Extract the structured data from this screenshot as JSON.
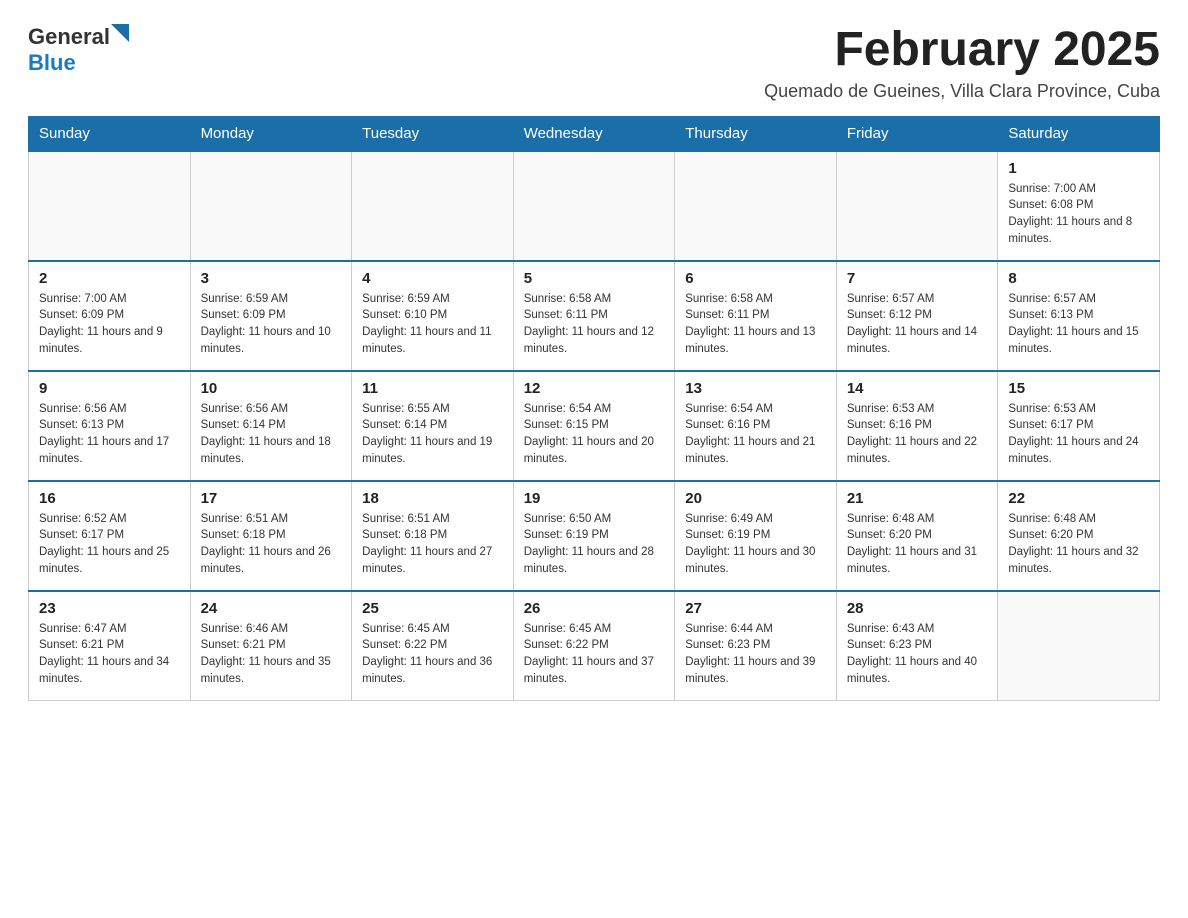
{
  "header": {
    "logo_general": "General",
    "logo_blue": "Blue",
    "month_title": "February 2025",
    "location": "Quemado de Gueines, Villa Clara Province, Cuba"
  },
  "days_of_week": [
    "Sunday",
    "Monday",
    "Tuesday",
    "Wednesday",
    "Thursday",
    "Friday",
    "Saturday"
  ],
  "weeks": [
    [
      {
        "day": "",
        "info": ""
      },
      {
        "day": "",
        "info": ""
      },
      {
        "day": "",
        "info": ""
      },
      {
        "day": "",
        "info": ""
      },
      {
        "day": "",
        "info": ""
      },
      {
        "day": "",
        "info": ""
      },
      {
        "day": "1",
        "info": "Sunrise: 7:00 AM\nSunset: 6:08 PM\nDaylight: 11 hours and 8 minutes."
      }
    ],
    [
      {
        "day": "2",
        "info": "Sunrise: 7:00 AM\nSunset: 6:09 PM\nDaylight: 11 hours and 9 minutes."
      },
      {
        "day": "3",
        "info": "Sunrise: 6:59 AM\nSunset: 6:09 PM\nDaylight: 11 hours and 10 minutes."
      },
      {
        "day": "4",
        "info": "Sunrise: 6:59 AM\nSunset: 6:10 PM\nDaylight: 11 hours and 11 minutes."
      },
      {
        "day": "5",
        "info": "Sunrise: 6:58 AM\nSunset: 6:11 PM\nDaylight: 11 hours and 12 minutes."
      },
      {
        "day": "6",
        "info": "Sunrise: 6:58 AM\nSunset: 6:11 PM\nDaylight: 11 hours and 13 minutes."
      },
      {
        "day": "7",
        "info": "Sunrise: 6:57 AM\nSunset: 6:12 PM\nDaylight: 11 hours and 14 minutes."
      },
      {
        "day": "8",
        "info": "Sunrise: 6:57 AM\nSunset: 6:13 PM\nDaylight: 11 hours and 15 minutes."
      }
    ],
    [
      {
        "day": "9",
        "info": "Sunrise: 6:56 AM\nSunset: 6:13 PM\nDaylight: 11 hours and 17 minutes."
      },
      {
        "day": "10",
        "info": "Sunrise: 6:56 AM\nSunset: 6:14 PM\nDaylight: 11 hours and 18 minutes."
      },
      {
        "day": "11",
        "info": "Sunrise: 6:55 AM\nSunset: 6:14 PM\nDaylight: 11 hours and 19 minutes."
      },
      {
        "day": "12",
        "info": "Sunrise: 6:54 AM\nSunset: 6:15 PM\nDaylight: 11 hours and 20 minutes."
      },
      {
        "day": "13",
        "info": "Sunrise: 6:54 AM\nSunset: 6:16 PM\nDaylight: 11 hours and 21 minutes."
      },
      {
        "day": "14",
        "info": "Sunrise: 6:53 AM\nSunset: 6:16 PM\nDaylight: 11 hours and 22 minutes."
      },
      {
        "day": "15",
        "info": "Sunrise: 6:53 AM\nSunset: 6:17 PM\nDaylight: 11 hours and 24 minutes."
      }
    ],
    [
      {
        "day": "16",
        "info": "Sunrise: 6:52 AM\nSunset: 6:17 PM\nDaylight: 11 hours and 25 minutes."
      },
      {
        "day": "17",
        "info": "Sunrise: 6:51 AM\nSunset: 6:18 PM\nDaylight: 11 hours and 26 minutes."
      },
      {
        "day": "18",
        "info": "Sunrise: 6:51 AM\nSunset: 6:18 PM\nDaylight: 11 hours and 27 minutes."
      },
      {
        "day": "19",
        "info": "Sunrise: 6:50 AM\nSunset: 6:19 PM\nDaylight: 11 hours and 28 minutes."
      },
      {
        "day": "20",
        "info": "Sunrise: 6:49 AM\nSunset: 6:19 PM\nDaylight: 11 hours and 30 minutes."
      },
      {
        "day": "21",
        "info": "Sunrise: 6:48 AM\nSunset: 6:20 PM\nDaylight: 11 hours and 31 minutes."
      },
      {
        "day": "22",
        "info": "Sunrise: 6:48 AM\nSunset: 6:20 PM\nDaylight: 11 hours and 32 minutes."
      }
    ],
    [
      {
        "day": "23",
        "info": "Sunrise: 6:47 AM\nSunset: 6:21 PM\nDaylight: 11 hours and 34 minutes."
      },
      {
        "day": "24",
        "info": "Sunrise: 6:46 AM\nSunset: 6:21 PM\nDaylight: 11 hours and 35 minutes."
      },
      {
        "day": "25",
        "info": "Sunrise: 6:45 AM\nSunset: 6:22 PM\nDaylight: 11 hours and 36 minutes."
      },
      {
        "day": "26",
        "info": "Sunrise: 6:45 AM\nSunset: 6:22 PM\nDaylight: 11 hours and 37 minutes."
      },
      {
        "day": "27",
        "info": "Sunrise: 6:44 AM\nSunset: 6:23 PM\nDaylight: 11 hours and 39 minutes."
      },
      {
        "day": "28",
        "info": "Sunrise: 6:43 AM\nSunset: 6:23 PM\nDaylight: 11 hours and 40 minutes."
      },
      {
        "day": "",
        "info": ""
      }
    ]
  ]
}
